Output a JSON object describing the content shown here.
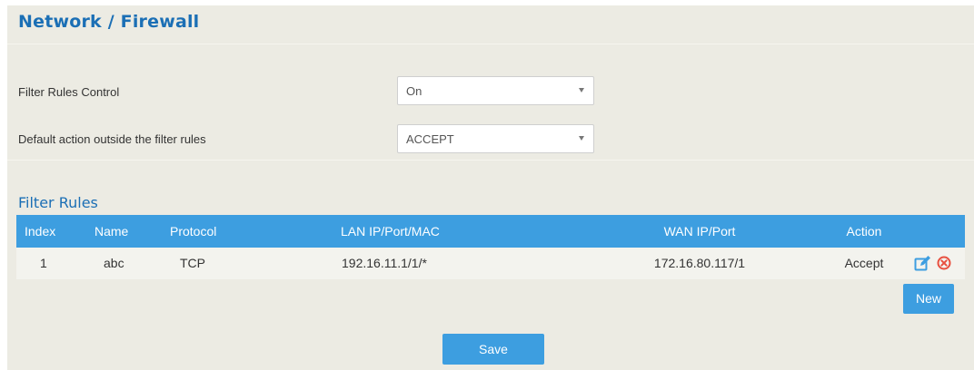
{
  "page": {
    "title": "Network / Firewall"
  },
  "settings": {
    "filter_rules_control": {
      "label": "Filter Rules Control",
      "value": "On"
    },
    "default_action": {
      "label": "Default action outside the filter rules",
      "value": "ACCEPT"
    }
  },
  "filter_rules": {
    "title": "Filter Rules",
    "columns": {
      "index": "Index",
      "name": "Name",
      "protocol": "Protocol",
      "lan": "LAN IP/Port/MAC",
      "wan": "WAN IP/Port",
      "action": "Action"
    },
    "rows": [
      {
        "index": "1",
        "name": "abc",
        "protocol": "TCP",
        "lan": "192.16.11.1/1/*",
        "wan": "172.16.80.117/1",
        "action": "Accept"
      }
    ],
    "new_label": "New"
  },
  "footer": {
    "save_label": "Save"
  },
  "colors": {
    "accent": "#3d9ee0",
    "title": "#1b6fb5",
    "panel_background": "#ecebe3",
    "delete_icon": "#e8503f"
  },
  "icons": {
    "row_edit": "edit-icon",
    "row_delete": "delete-icon",
    "select_arrow": "chevron-down-icon"
  }
}
